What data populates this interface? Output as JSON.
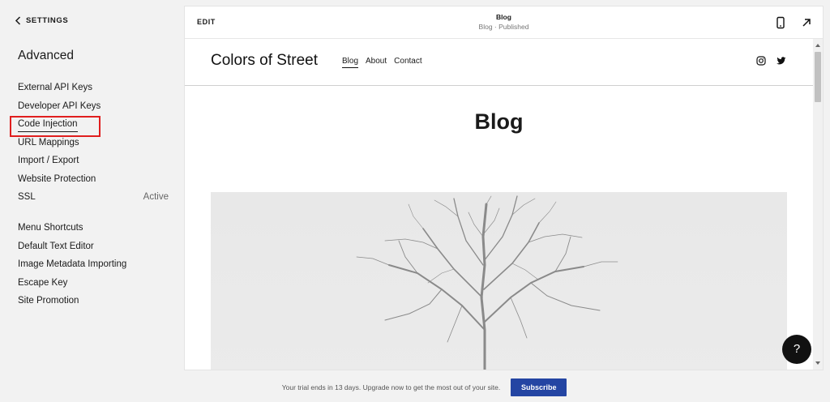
{
  "sidebar": {
    "back_label": "SETTINGS",
    "title": "Advanced",
    "group1": [
      {
        "label": "External API Keys"
      },
      {
        "label": "Developer API Keys"
      },
      {
        "label": "Code Injection"
      },
      {
        "label": "URL Mappings"
      },
      {
        "label": "Import / Export"
      },
      {
        "label": "Website Protection"
      },
      {
        "label": "SSL",
        "value": "Active"
      }
    ],
    "group2": [
      {
        "label": "Menu Shortcuts"
      },
      {
        "label": "Default Text Editor"
      },
      {
        "label": "Image Metadata Importing"
      },
      {
        "label": "Escape Key"
      },
      {
        "label": "Site Promotion"
      }
    ],
    "highlight_color": "#e01e1e"
  },
  "preview": {
    "edit_label": "EDIT",
    "page_title": "Blog",
    "page_status": "Blog · Published",
    "icons": [
      "mobile-preview-icon",
      "open-external-icon"
    ]
  },
  "site": {
    "logo": "Colors of Street",
    "nav": [
      "Blog",
      "About",
      "Contact"
    ],
    "active_nav": "Blog",
    "social": [
      "instagram-icon",
      "twitter-icon"
    ],
    "heading": "Blog"
  },
  "help_label": "?",
  "trial_bar": {
    "message": "Your trial ends in 13 days. Upgrade now to get the most out of your site.",
    "subscribe_label": "Subscribe",
    "accent": "#2445a3"
  }
}
